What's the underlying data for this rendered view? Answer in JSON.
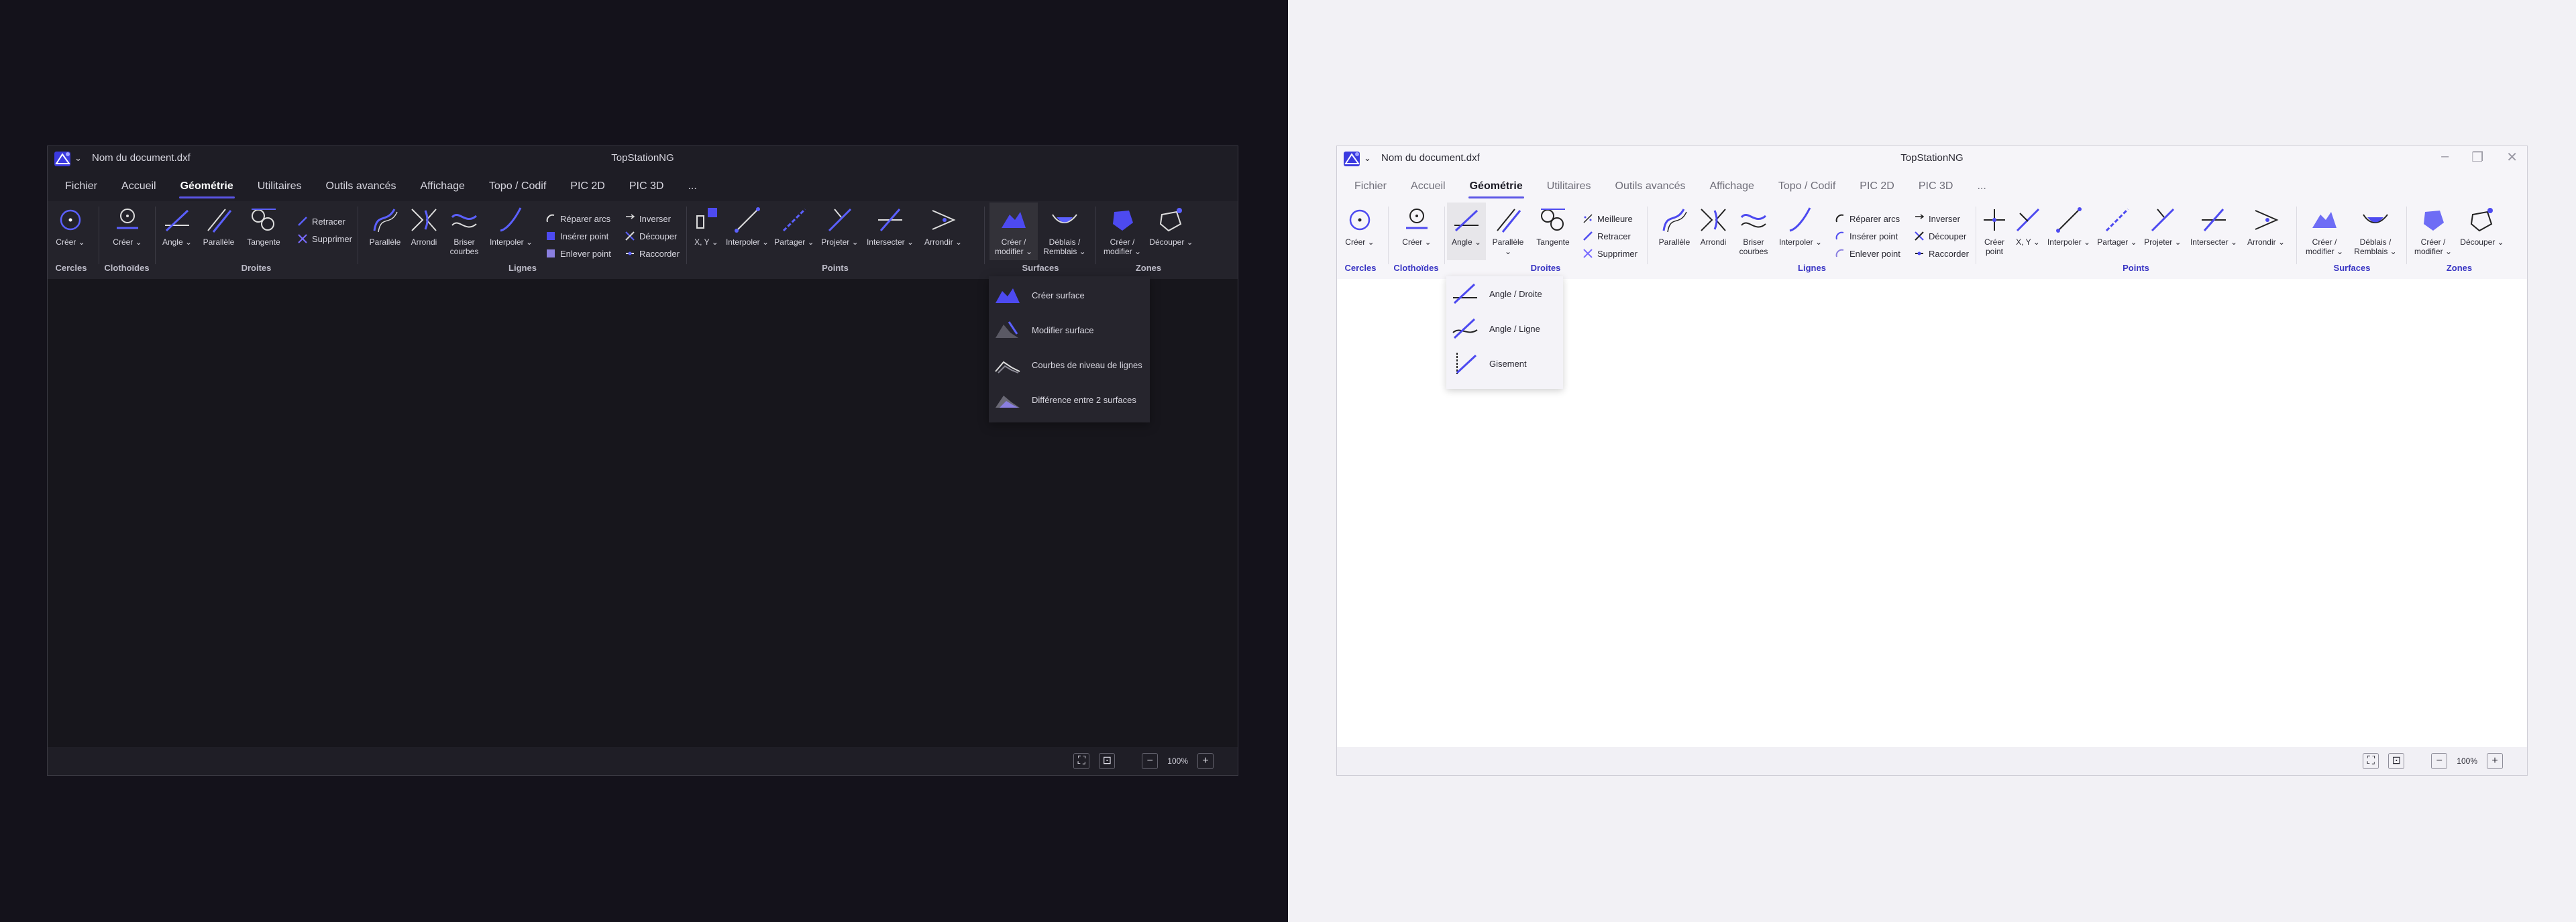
{
  "colors": {
    "accent": "#5b55e6",
    "icon_blue": "#4d4af0",
    "icon_light": "#6e6df5"
  },
  "dark": {
    "doc_title": "Nom du document.dxf",
    "app_title": "TopStationNG",
    "tabs": [
      "Fichier",
      "Accueil",
      "Géométrie",
      "Utilitaires",
      "Outils avancés",
      "Affichage",
      "Topo / Codif",
      "PIC 2D",
      "PIC 3D",
      "..."
    ],
    "ribbon": {
      "creer_cercle": "Créer",
      "creer_clotho": "Créer",
      "angle": "Angle",
      "parallele": "Parallèle",
      "tangente": "Tangente",
      "retracer": "Retracer",
      "supprimer": "Supprimer",
      "parallele2": "Parallèle",
      "arrondi": "Arrondi",
      "briser_courbes": "Briser courbes",
      "interpoler": "Interpoler",
      "reparer_arcs": "Réparer arcs",
      "inserer_point": "Insérer point",
      "enlever_point": "Enlever point",
      "inverser": "Inverser",
      "decouper": "Découper",
      "raccorder": "Raccorder",
      "xy": "X, Y",
      "interpoler_pt": "Interpoler",
      "partager": "Partager",
      "projeter": "Projeter",
      "intersecter": "Intersecter",
      "arrondir": "Arrondir",
      "creer_modifier_surf": "Créer / modifier",
      "deblais_remblais": "Déblais / Remblais",
      "creer_modifier_zone": "Créer / modifier",
      "decouper_zone": "Découper"
    },
    "groups": {
      "cercles": "Cercles",
      "clothoides": "Clothoïdes",
      "droites": "Droites",
      "lignes": "Lignes",
      "points": "Points",
      "surfaces": "Surfaces",
      "zones": "Zones"
    },
    "dropdown": [
      "Créer surface",
      "Modifier surface",
      "Courbes de niveau de lignes",
      "Différence entre 2 surfaces"
    ],
    "zoom": "100%"
  },
  "light": {
    "doc_title": "Nom du document.dxf",
    "app_title": "TopStationNG",
    "tabs": [
      "Fichier",
      "Accueil",
      "Géométrie",
      "Utilitaires",
      "Outils avancés",
      "Affichage",
      "Topo / Codif",
      "PIC 2D",
      "PIC 3D",
      "..."
    ],
    "ribbon": {
      "creer_cercle": "Créer",
      "creer_clotho": "Créer",
      "angle": "Angle",
      "parallele": "Parallèle",
      "tangente": "Tangente",
      "meilleure": "Meilleure",
      "retracer": "Retracer",
      "supprimer": "Supprimer",
      "parallele2": "Parallèle",
      "arrondi": "Arrondi",
      "briser_courbes": "Briser courbes",
      "interpoler": "Interpoler",
      "reparer_arcs": "Réparer arcs",
      "inserer_point": "Insérer point",
      "enlever_point": "Enlever point",
      "inverser": "Inverser",
      "decouper": "Découper",
      "raccorder": "Raccorder",
      "creer_point": "Créer point",
      "xy": "X, Y",
      "interpoler_pt": "Interpoler",
      "partager": "Partager",
      "projeter": "Projeter",
      "intersecter": "Intersecter",
      "arrondir": "Arrondir",
      "creer_modifier_surf": "Créer / modifier",
      "deblais_remblais": "Déblais / Remblais",
      "creer_modifier_zone": "Créer / modifier",
      "decouper_zone": "Découper"
    },
    "groups": {
      "cercles": "Cercles",
      "clothoides": "Clothoïdes",
      "droites": "Droites",
      "lignes": "Lignes",
      "points": "Points",
      "surfaces": "Surfaces",
      "zones": "Zones"
    },
    "dropdown": [
      "Angle / Droite",
      "Angle / Ligne",
      "Gisement"
    ],
    "zoom": "100%"
  }
}
